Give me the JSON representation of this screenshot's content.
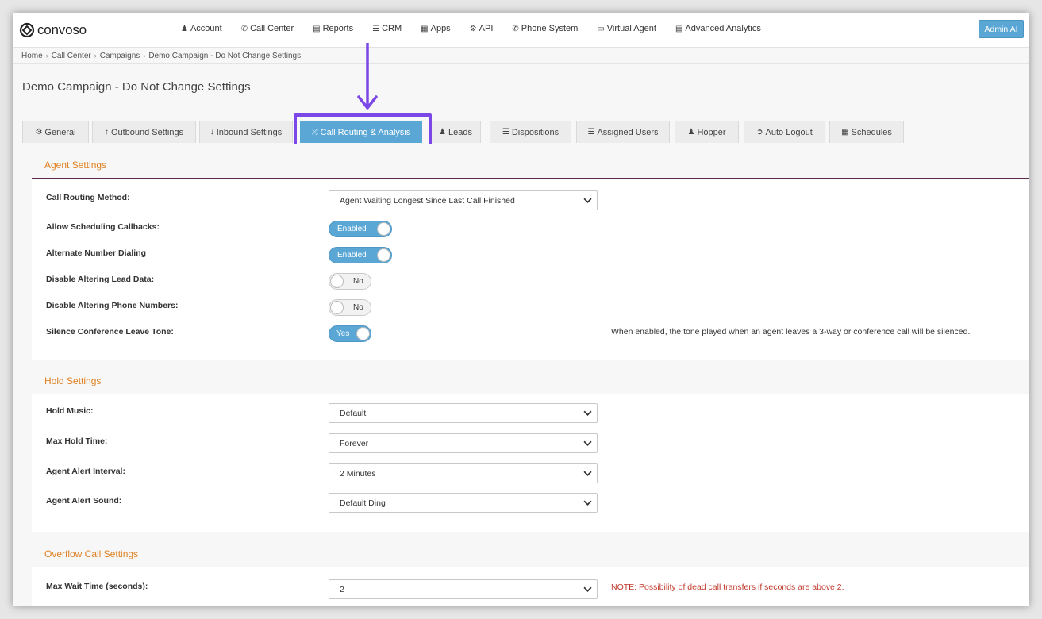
{
  "app": {
    "brand": "convoso"
  },
  "nav": {
    "items": [
      {
        "label": "Account",
        "icon": "user-icon"
      },
      {
        "label": "Call Center",
        "icon": "phone-icon"
      },
      {
        "label": "Reports",
        "icon": "bar-chart-icon"
      },
      {
        "label": "CRM",
        "icon": "list-icon"
      },
      {
        "label": "Apps",
        "icon": "grid-icon"
      },
      {
        "label": "API",
        "icon": "gear-icon"
      },
      {
        "label": "Phone System",
        "icon": "phone-icon"
      },
      {
        "label": "Virtual Agent",
        "icon": "monitor-icon"
      },
      {
        "label": "Advanced Analytics",
        "icon": "bar-chart-icon"
      }
    ],
    "admin_label": "Admin AI"
  },
  "breadcrumb": [
    "Home",
    "Call Center",
    "Campaigns",
    "Demo Campaign - Do Not Change Settings"
  ],
  "page": {
    "title": "Demo Campaign - Do Not Change Settings"
  },
  "tabs": [
    {
      "label": "General",
      "icon": "gears-icon"
    },
    {
      "label": "Outbound Settings",
      "icon": "arrow-up-icon"
    },
    {
      "label": "Inbound Settings",
      "icon": "arrow-down-icon"
    },
    {
      "label": "Call Routing & Analysis",
      "icon": "shuffle-icon",
      "active": true
    },
    {
      "label": "Leads",
      "icon": "users-icon"
    },
    {
      "label": "Dispositions",
      "icon": "list-icon"
    },
    {
      "label": "Assigned Users",
      "icon": "ordered-list-icon"
    },
    {
      "label": "Hopper",
      "icon": "users-icon"
    },
    {
      "label": "Auto Logout",
      "icon": "sign-out-icon"
    },
    {
      "label": "Schedules",
      "icon": "calendar-icon"
    }
  ],
  "agent_settings": {
    "title": "Agent Settings",
    "call_routing_method": {
      "label": "Call Routing Method:",
      "value": "Agent Waiting Longest Since Last Call Finished"
    },
    "allow_scheduling_callbacks": {
      "label": "Allow Scheduling Callbacks:",
      "value": "Enabled"
    },
    "alternate_number_dialing": {
      "label": "Alternate Number Dialing",
      "value": "Enabled"
    },
    "disable_altering_lead_data": {
      "label": "Disable Altering Lead Data:",
      "value": "No"
    },
    "disable_altering_phone_numbers": {
      "label": "Disable Altering Phone Numbers:",
      "value": "No"
    },
    "silence_conference_leave_tone": {
      "label": "Silence Conference Leave Tone:",
      "value": "Yes",
      "help": "When enabled, the tone played when an agent leaves a 3-way or conference call will be silenced."
    }
  },
  "hold_settings": {
    "title": "Hold Settings",
    "hold_music": {
      "label": "Hold Music:",
      "value": "Default"
    },
    "max_hold_time": {
      "label": "Max Hold Time:",
      "value": "Forever"
    },
    "agent_alert_interval": {
      "label": "Agent Alert Interval:",
      "value": "2 Minutes"
    },
    "agent_alert_sound": {
      "label": "Agent Alert Sound:",
      "value": "Default Ding"
    }
  },
  "overflow_settings": {
    "title": "Overflow Call Settings",
    "max_wait_time": {
      "label": "Max Wait Time (seconds):",
      "value": "2",
      "note": "NOTE: Possibility of dead call transfers if seconds are above 2."
    }
  },
  "colors": {
    "accent": "#5aa7d6",
    "section_title": "#e0801f",
    "highlight": "#7b47e6",
    "note": "#c0392b"
  }
}
